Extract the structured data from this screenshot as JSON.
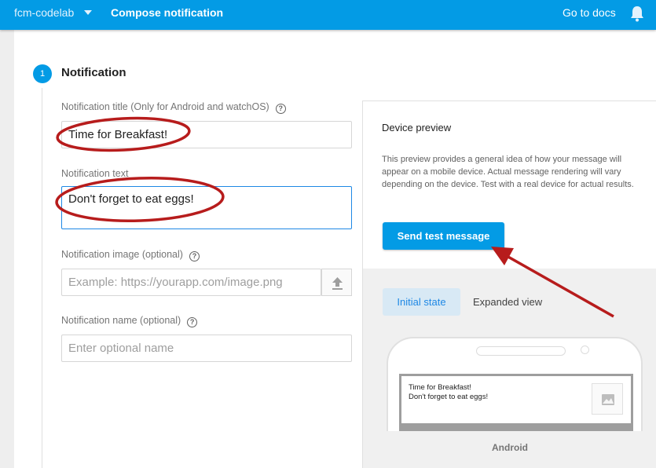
{
  "topbar": {
    "project_name": "fcm-codelab",
    "page_title": "Compose notification",
    "docs_link": "Go to docs"
  },
  "step": {
    "number": "1",
    "title": "Notification"
  },
  "fields": {
    "title_label": "Notification title (Only for Android and watchOS)",
    "title_value": "Time for Breakfast!",
    "text_label": "Notification text",
    "text_value": "Don't forget to eat eggs!",
    "image_label": "Notification image (optional)",
    "image_placeholder": "Example: https://yourapp.com/image.png",
    "name_label": "Notification name (optional)",
    "name_placeholder": "Enter optional name",
    "help_glyph": "?"
  },
  "preview": {
    "title": "Device preview",
    "description": "This preview provides a general idea of how your message will appear on a mobile device. Actual message rendering will vary depending on the device. Test with a real device for actual results.",
    "send_button": "Send test message",
    "tabs": [
      "Initial state",
      "Expanded view"
    ],
    "notification_title": "Time for Breakfast!",
    "notification_text": "Don't forget to eat eggs!",
    "os_label": "Android"
  },
  "icons": {
    "project_caret": "chevron-down-icon",
    "bell": "bell-icon",
    "help": "help-circle-icon",
    "upload": "upload-icon",
    "image": "image-icon"
  },
  "colors": {
    "topbar": "#039be5",
    "accent": "#039be5",
    "annotation": "#b71c1c"
  }
}
